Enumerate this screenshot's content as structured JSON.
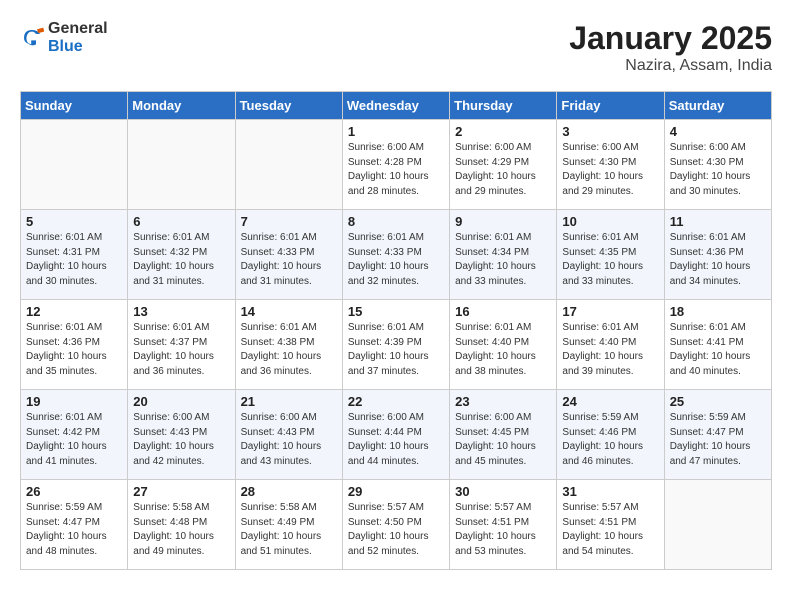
{
  "app": {
    "name_general": "General",
    "name_blue": "Blue",
    "title": "January 2025",
    "subtitle": "Nazira, Assam, India"
  },
  "calendar": {
    "headers": [
      "Sunday",
      "Monday",
      "Tuesday",
      "Wednesday",
      "Thursday",
      "Friday",
      "Saturday"
    ],
    "weeks": [
      [
        {
          "day": "",
          "info": ""
        },
        {
          "day": "",
          "info": ""
        },
        {
          "day": "",
          "info": ""
        },
        {
          "day": "1",
          "info": "Sunrise: 6:00 AM\nSunset: 4:28 PM\nDaylight: 10 hours\nand 28 minutes."
        },
        {
          "day": "2",
          "info": "Sunrise: 6:00 AM\nSunset: 4:29 PM\nDaylight: 10 hours\nand 29 minutes."
        },
        {
          "day": "3",
          "info": "Sunrise: 6:00 AM\nSunset: 4:30 PM\nDaylight: 10 hours\nand 29 minutes."
        },
        {
          "day": "4",
          "info": "Sunrise: 6:00 AM\nSunset: 4:30 PM\nDaylight: 10 hours\nand 30 minutes."
        }
      ],
      [
        {
          "day": "5",
          "info": "Sunrise: 6:01 AM\nSunset: 4:31 PM\nDaylight: 10 hours\nand 30 minutes."
        },
        {
          "day": "6",
          "info": "Sunrise: 6:01 AM\nSunset: 4:32 PM\nDaylight: 10 hours\nand 31 minutes."
        },
        {
          "day": "7",
          "info": "Sunrise: 6:01 AM\nSunset: 4:33 PM\nDaylight: 10 hours\nand 31 minutes."
        },
        {
          "day": "8",
          "info": "Sunrise: 6:01 AM\nSunset: 4:33 PM\nDaylight: 10 hours\nand 32 minutes."
        },
        {
          "day": "9",
          "info": "Sunrise: 6:01 AM\nSunset: 4:34 PM\nDaylight: 10 hours\nand 33 minutes."
        },
        {
          "day": "10",
          "info": "Sunrise: 6:01 AM\nSunset: 4:35 PM\nDaylight: 10 hours\nand 33 minutes."
        },
        {
          "day": "11",
          "info": "Sunrise: 6:01 AM\nSunset: 4:36 PM\nDaylight: 10 hours\nand 34 minutes."
        }
      ],
      [
        {
          "day": "12",
          "info": "Sunrise: 6:01 AM\nSunset: 4:36 PM\nDaylight: 10 hours\nand 35 minutes."
        },
        {
          "day": "13",
          "info": "Sunrise: 6:01 AM\nSunset: 4:37 PM\nDaylight: 10 hours\nand 36 minutes."
        },
        {
          "day": "14",
          "info": "Sunrise: 6:01 AM\nSunset: 4:38 PM\nDaylight: 10 hours\nand 36 minutes."
        },
        {
          "day": "15",
          "info": "Sunrise: 6:01 AM\nSunset: 4:39 PM\nDaylight: 10 hours\nand 37 minutes."
        },
        {
          "day": "16",
          "info": "Sunrise: 6:01 AM\nSunset: 4:40 PM\nDaylight: 10 hours\nand 38 minutes."
        },
        {
          "day": "17",
          "info": "Sunrise: 6:01 AM\nSunset: 4:40 PM\nDaylight: 10 hours\nand 39 minutes."
        },
        {
          "day": "18",
          "info": "Sunrise: 6:01 AM\nSunset: 4:41 PM\nDaylight: 10 hours\nand 40 minutes."
        }
      ],
      [
        {
          "day": "19",
          "info": "Sunrise: 6:01 AM\nSunset: 4:42 PM\nDaylight: 10 hours\nand 41 minutes."
        },
        {
          "day": "20",
          "info": "Sunrise: 6:00 AM\nSunset: 4:43 PM\nDaylight: 10 hours\nand 42 minutes."
        },
        {
          "day": "21",
          "info": "Sunrise: 6:00 AM\nSunset: 4:43 PM\nDaylight: 10 hours\nand 43 minutes."
        },
        {
          "day": "22",
          "info": "Sunrise: 6:00 AM\nSunset: 4:44 PM\nDaylight: 10 hours\nand 44 minutes."
        },
        {
          "day": "23",
          "info": "Sunrise: 6:00 AM\nSunset: 4:45 PM\nDaylight: 10 hours\nand 45 minutes."
        },
        {
          "day": "24",
          "info": "Sunrise: 5:59 AM\nSunset: 4:46 PM\nDaylight: 10 hours\nand 46 minutes."
        },
        {
          "day": "25",
          "info": "Sunrise: 5:59 AM\nSunset: 4:47 PM\nDaylight: 10 hours\nand 47 minutes."
        }
      ],
      [
        {
          "day": "26",
          "info": "Sunrise: 5:59 AM\nSunset: 4:47 PM\nDaylight: 10 hours\nand 48 minutes."
        },
        {
          "day": "27",
          "info": "Sunrise: 5:58 AM\nSunset: 4:48 PM\nDaylight: 10 hours\nand 49 minutes."
        },
        {
          "day": "28",
          "info": "Sunrise: 5:58 AM\nSunset: 4:49 PM\nDaylight: 10 hours\nand 51 minutes."
        },
        {
          "day": "29",
          "info": "Sunrise: 5:57 AM\nSunset: 4:50 PM\nDaylight: 10 hours\nand 52 minutes."
        },
        {
          "day": "30",
          "info": "Sunrise: 5:57 AM\nSunset: 4:51 PM\nDaylight: 10 hours\nand 53 minutes."
        },
        {
          "day": "31",
          "info": "Sunrise: 5:57 AM\nSunset: 4:51 PM\nDaylight: 10 hours\nand 54 minutes."
        },
        {
          "day": "",
          "info": ""
        }
      ]
    ]
  }
}
